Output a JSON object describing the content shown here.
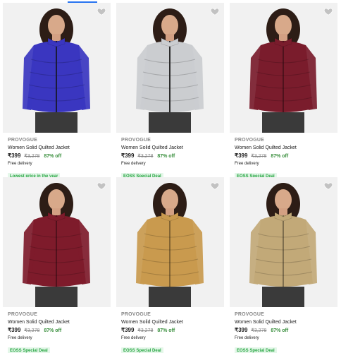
{
  "colors": {
    "discount": "#388e3c",
    "badge_text": "#26a541",
    "badge_bg": "#e4f7e9",
    "link": "#2874f0"
  },
  "products": [
    {
      "brand": "PROVOGUE",
      "title": "Women Solid Quilted Jacket",
      "price": "₹399",
      "mrp": "₹3,278",
      "discount": "87% off",
      "delivery": "Free delivery",
      "badge": "Lowest price in the year",
      "jacket_color": "#3a36c0",
      "wishlist_icon": "heart-icon"
    },
    {
      "brand": "PROVOGUE",
      "title": "Women Solid Quilted Jacket",
      "price": "₹399",
      "mrp": "₹3,278",
      "discount": "87% off",
      "delivery": "Free delivery",
      "badge": "EOSS Special Deal",
      "jacket_color": "#cbcdd0",
      "wishlist_icon": "heart-icon"
    },
    {
      "brand": "PROVOGUE",
      "title": "Women Solid Quilted Jacket",
      "price": "₹399",
      "mrp": "₹3,278",
      "discount": "87% off",
      "delivery": "Free delivery",
      "badge": "EOSS Special Deal",
      "jacket_color": "#7a1c2c",
      "wishlist_icon": "heart-icon"
    },
    {
      "brand": "PROVOGUE",
      "title": "Women Solid Quilted Jacket",
      "price": "₹399",
      "mrp": "₹3,278",
      "discount": "87% off",
      "delivery": "Free delivery",
      "badge": "EOSS Special Deal",
      "jacket_color": "#7e1b2b",
      "wishlist_icon": "heart-icon"
    },
    {
      "brand": "PROVOGUE",
      "title": "Women Solid Quilted Jacket",
      "price": "₹399",
      "mrp": "₹3,278",
      "discount": "87% off",
      "delivery": "Free delivery",
      "badge": "EOSS Special Deal",
      "jacket_color": "#c99a4e",
      "wishlist_icon": "heart-icon"
    },
    {
      "brand": "PROVOGUE",
      "title": "Women Solid Quilted Jacket",
      "price": "₹399",
      "mrp": "₹3,278",
      "discount": "87% off",
      "delivery": "Free delivery",
      "badge": "EOSS Special Deal",
      "jacket_color": "#c2a978",
      "wishlist_icon": "heart-icon"
    }
  ]
}
